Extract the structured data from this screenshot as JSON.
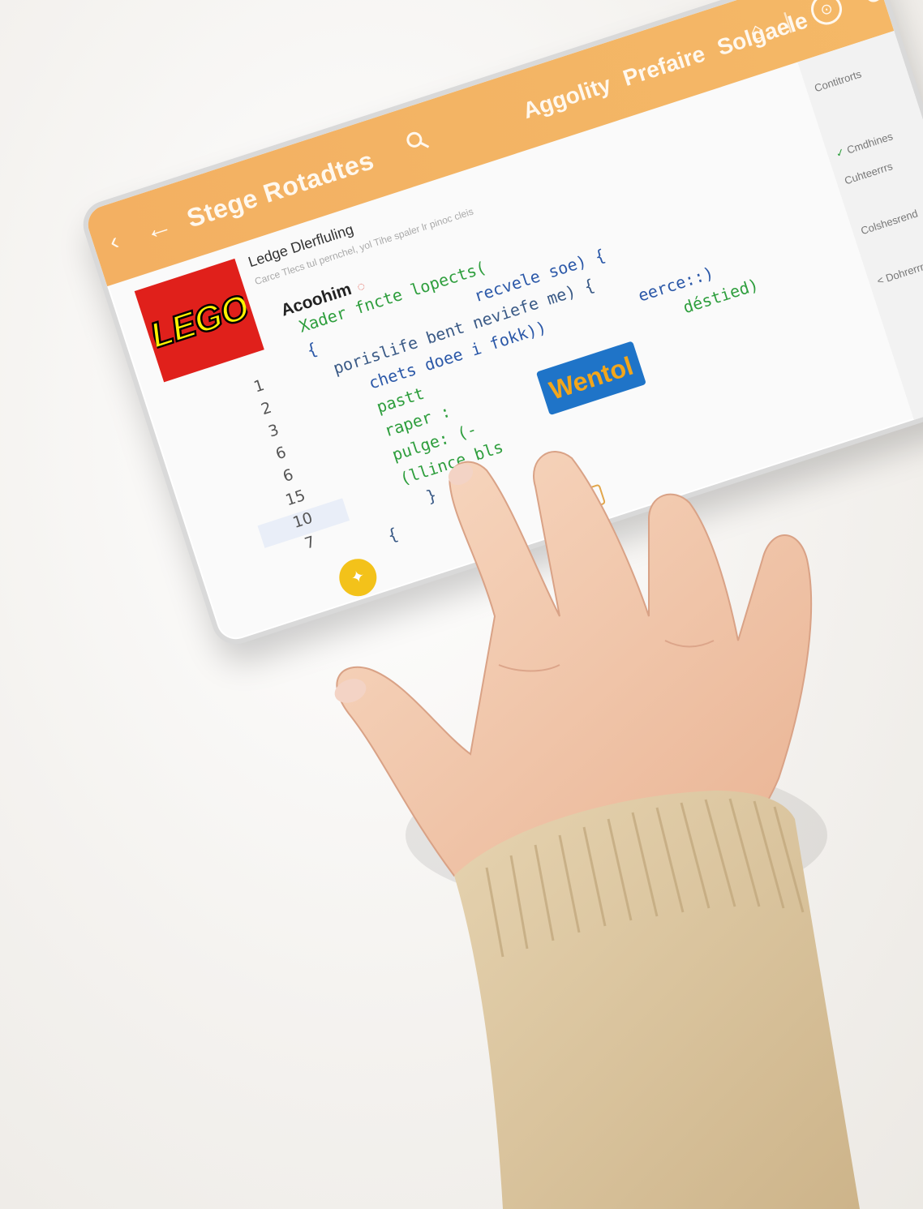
{
  "header": {
    "back_chevron": "‹",
    "back_arrow": "←",
    "title": "Stege Rotadtes",
    "search_icon": "search-icon",
    "tabs_text": "Aggolity Prefaire Solgaele",
    "home_icon": "⌂",
    "divider": "|",
    "ring_icon_text": "⊙"
  },
  "document": {
    "title": "Ledge Dlerfluling",
    "subtitle": "Carce Tlecs tul pernchel, yol Tihe spaler lr pinoc cleis",
    "section": "Acoohim",
    "badge": "◌"
  },
  "gutter": {
    "lines": [
      "1",
      "2",
      "3",
      "6",
      "6",
      "15",
      "10",
      "7"
    ]
  },
  "code": {
    "lines": [
      {
        "text": "Xader fncte lopects(",
        "cls": "c-green"
      },
      {
        "text": "{                 recvele soe) {",
        "cls": "c-blue"
      },
      {
        "text": "  porislife bent neviefe me) {",
        "cls": "c-dark"
      },
      {
        "text": "     chets doee i fokk))          eerce::)",
        "cls": "c-blue"
      },
      {
        "text": "     pastt                            déstied)",
        "cls": "c-green"
      },
      {
        "text": "     raper :",
        "cls": "c-green"
      },
      {
        "text": "     pulge: (-",
        "cls": "c-green"
      },
      {
        "text": "     (llince bls",
        "cls": "c-green"
      },
      {
        "text": "       }",
        "cls": "c-dark"
      },
      {
        "text": "  {",
        "cls": "c-dark"
      }
    ]
  },
  "highlight": {
    "text": "Wentol"
  },
  "sidepanel": {
    "items": [
      {
        "label": "Contitrorts",
        "check": ""
      },
      {
        "label": "Cmdhines",
        "check": "✓ "
      },
      {
        "label": "Cuhteerrrs",
        "check": ""
      },
      {
        "label": "Colshesrend",
        "check": ""
      },
      {
        "label": "< Dohrerrrcs",
        "check": ""
      }
    ]
  },
  "logo": {
    "text": "LEGO",
    "bg": "#e0201b",
    "fg": "#fff200"
  },
  "fab_icon": "✦",
  "mini_icon": "▭",
  "colors": {
    "topbar": "#f3b062",
    "sleeve": "#dcc7a0",
    "skin": "#f2c9ad"
  }
}
